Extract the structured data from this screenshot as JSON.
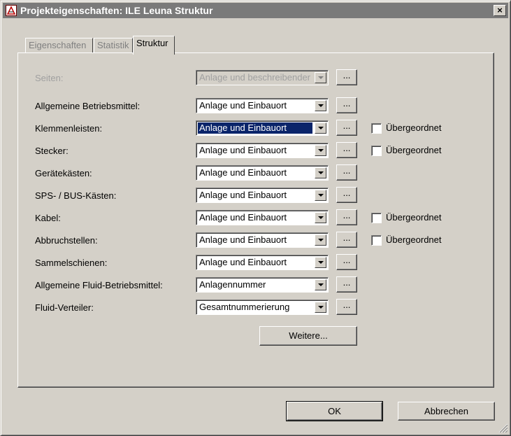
{
  "window": {
    "title": "Projekteigenschaften: ILE Leuna Struktur",
    "close_label": "×"
  },
  "tabs": [
    {
      "label": "Eigenschaften",
      "active": false
    },
    {
      "label": "Statistik",
      "active": false
    },
    {
      "label": "Struktur",
      "active": true
    }
  ],
  "rows": [
    {
      "label": "Seiten:",
      "value": "Anlage und beschreibender",
      "disabled": true,
      "selected": false,
      "check": null
    },
    {
      "label": "Allgemeine Betriebsmittel:",
      "value": "Anlage und Einbauort",
      "disabled": false,
      "selected": false,
      "check": null
    },
    {
      "label": "Klemmenleisten:",
      "value": "Anlage und Einbauort",
      "disabled": false,
      "selected": true,
      "check": "Übergeordnet"
    },
    {
      "label": "Stecker:",
      "value": "Anlage und Einbauort",
      "disabled": false,
      "selected": false,
      "check": "Übergeordnet"
    },
    {
      "label": "Gerätekästen:",
      "value": "Anlage und Einbauort",
      "disabled": false,
      "selected": false,
      "check": null
    },
    {
      "label": "SPS- / BUS-Kästen:",
      "value": "Anlage und Einbauort",
      "disabled": false,
      "selected": false,
      "check": null
    },
    {
      "label": "Kabel:",
      "value": "Anlage und Einbauort",
      "disabled": false,
      "selected": false,
      "check": "Übergeordnet"
    },
    {
      "label": "Abbruchstellen:",
      "value": "Anlage und Einbauort",
      "disabled": false,
      "selected": false,
      "check": "Übergeordnet"
    },
    {
      "label": "Sammelschienen:",
      "value": "Anlage und Einbauort",
      "disabled": false,
      "selected": false,
      "check": null
    },
    {
      "label": "Allgemeine Fluid-Betriebsmittel:",
      "value": "Anlagennummer",
      "disabled": false,
      "selected": false,
      "check": null
    },
    {
      "label": "Fluid-Verteiler:",
      "value": "Gesamtnummerierung",
      "disabled": false,
      "selected": false,
      "check": null
    }
  ],
  "dots_label": "...",
  "buttons": {
    "weitere": "Weitere...",
    "ok": "OK",
    "cancel": "Abbrechen"
  },
  "colors": {
    "face": "#d4d0c8",
    "titlebar": "#7a7a7a",
    "selection": "#0a246a"
  }
}
